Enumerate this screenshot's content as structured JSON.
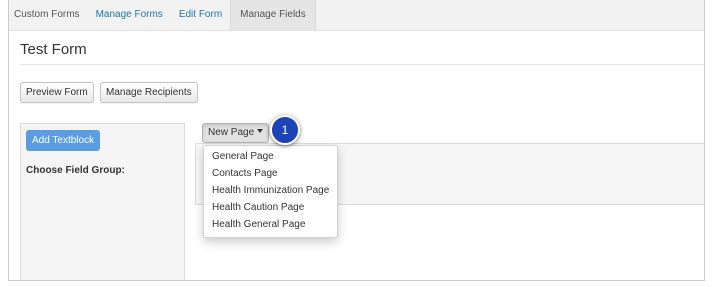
{
  "colors": {
    "link": "#1f76b8",
    "accent": "#5b9de1",
    "callout": "#1e43b6"
  },
  "tabs": [
    {
      "label": "Custom Forms"
    },
    {
      "label": "Manage Forms"
    },
    {
      "label": "Edit Form"
    },
    {
      "label": "Manage Fields",
      "active": true
    }
  ],
  "page": {
    "title": "Test Form"
  },
  "toolbar": {
    "preview_form_label": "Preview Form",
    "manage_recipients_label": "Manage Recipients"
  },
  "field_panel": {
    "add_textblock_label": "Add Textblock",
    "field_group_label": "Choose Field Group:"
  },
  "page_menu": {
    "button_label": "New Page",
    "button_icon": "caret-down-icon",
    "items": [
      {
        "label": "General Page"
      },
      {
        "label": "Contacts Page"
      },
      {
        "label": "Health Immunization Page"
      },
      {
        "label": "Health Caution Page"
      },
      {
        "label": "Health General Page"
      }
    ]
  },
  "callout": {
    "number": "1"
  }
}
